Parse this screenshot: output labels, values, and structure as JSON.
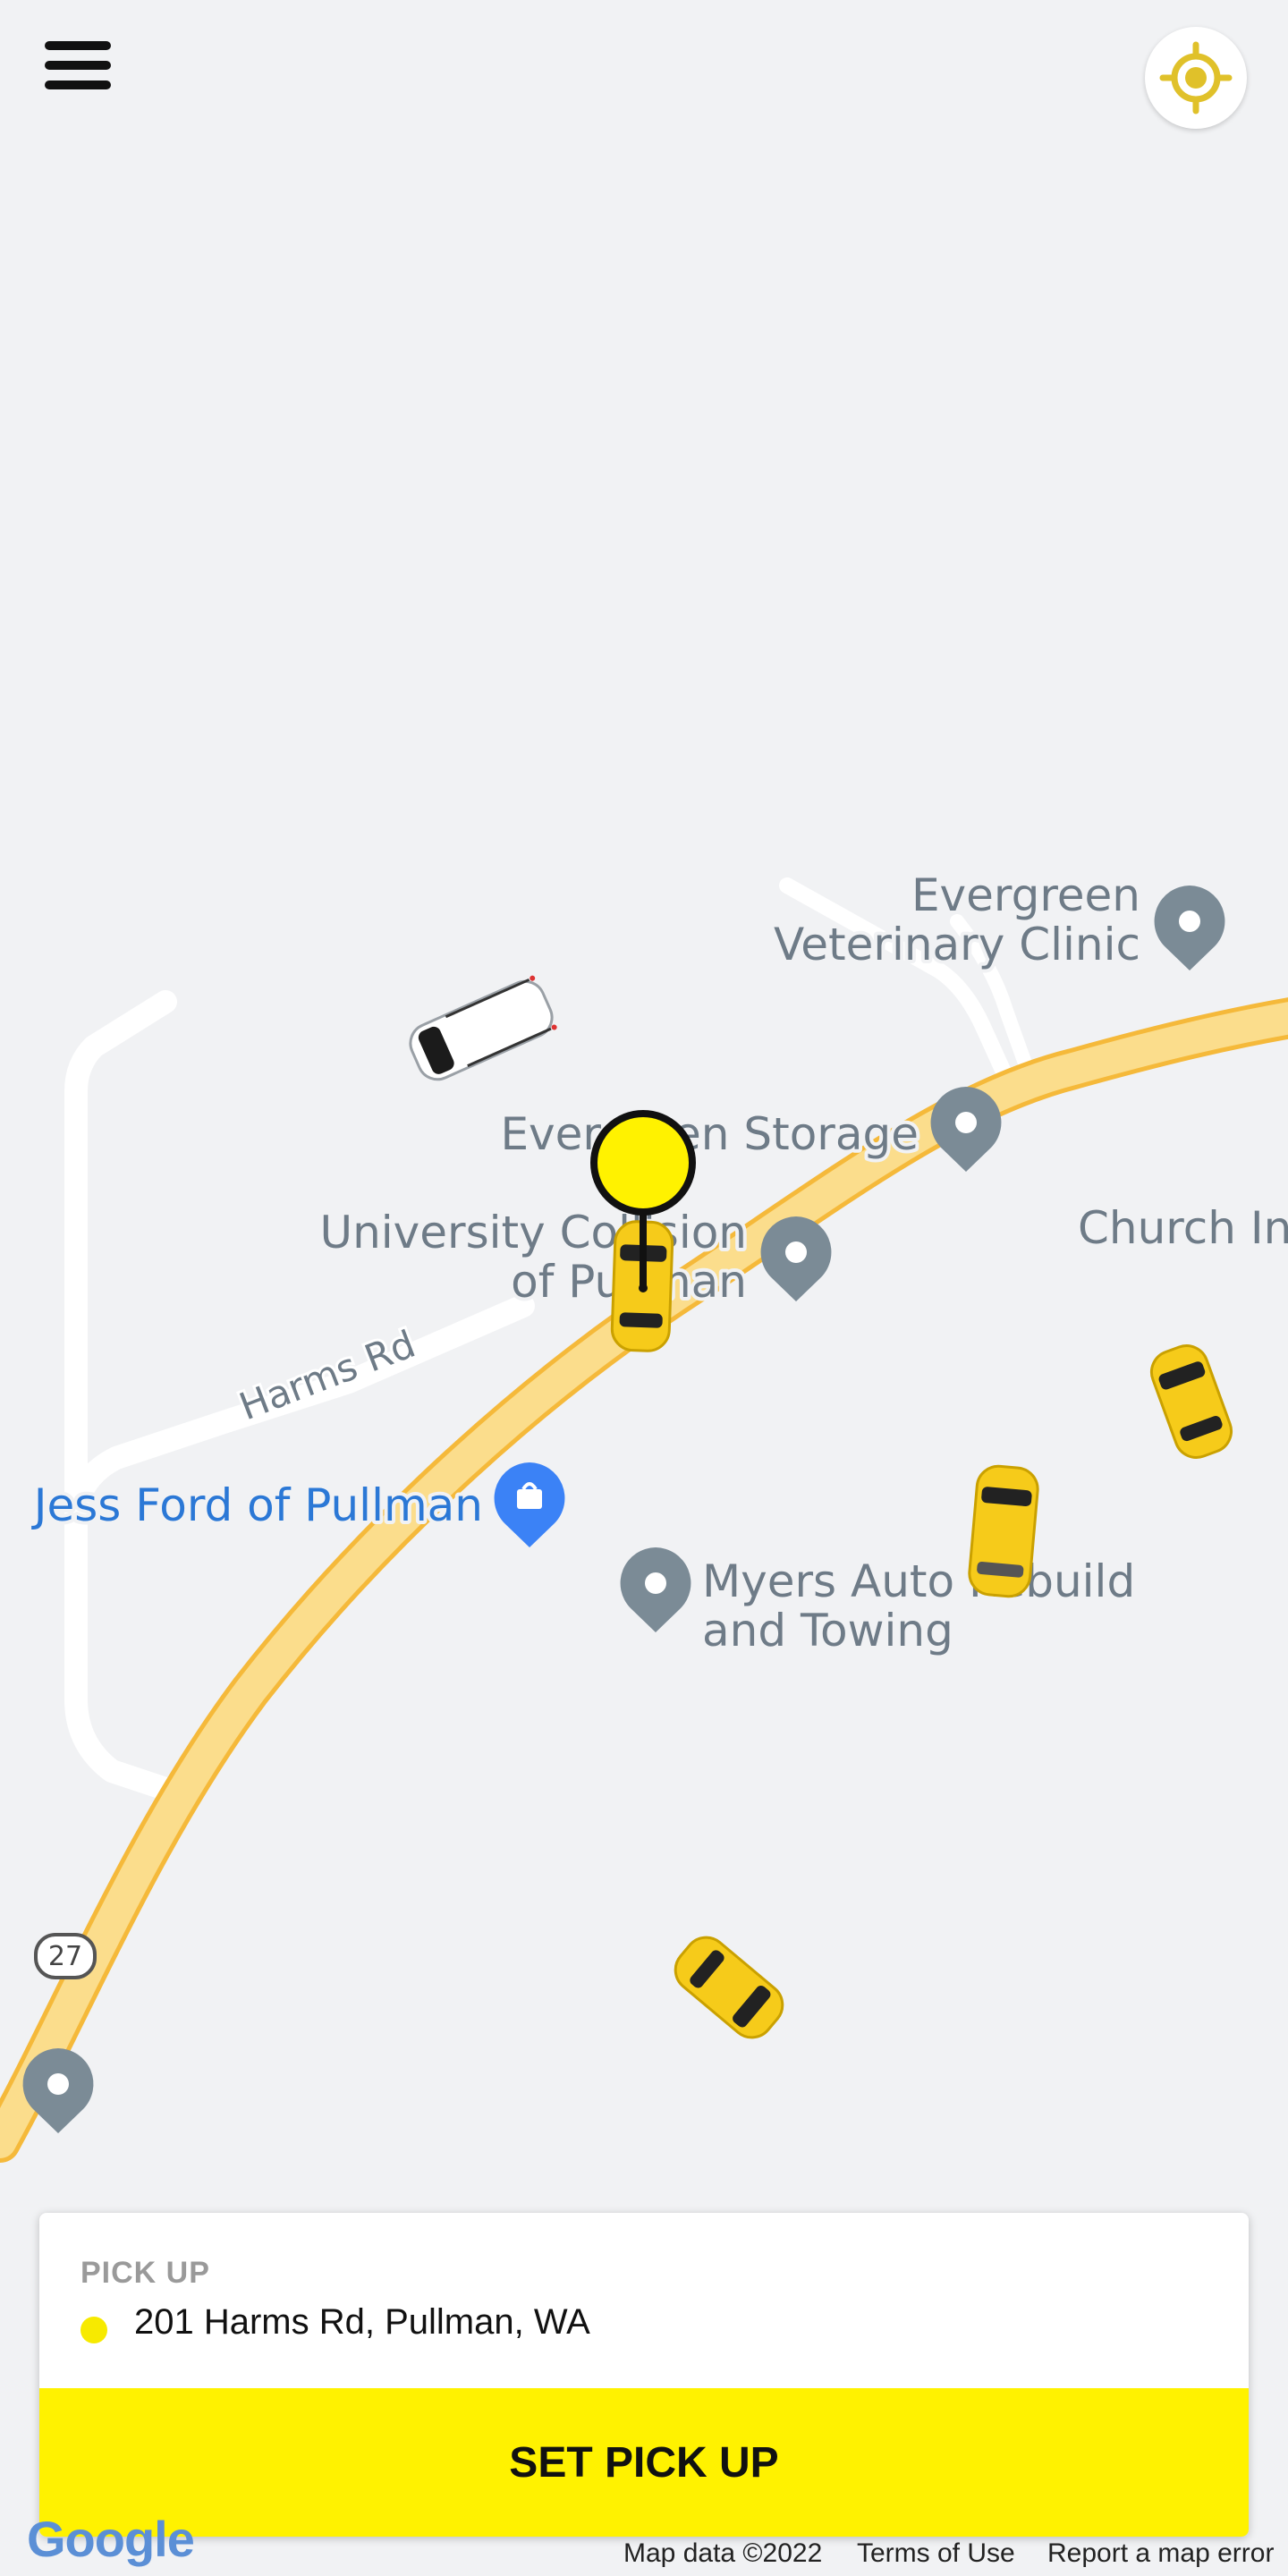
{
  "map": {
    "pois": {
      "evergreen_vet": [
        "Evergreen",
        "Veterinary Clinic"
      ],
      "evergreen_storage": "Evergreen Storage",
      "university_collision": [
        "University Collision",
        "of Pullman"
      ],
      "church": "Church In",
      "jess_ford": "Jess Ford of Pullman",
      "myers_auto": [
        "Myers Auto Rebuild",
        "and Towing"
      ]
    },
    "roads": {
      "harms_rd": "Harms Rd",
      "highway_shield": "27"
    }
  },
  "top_bar": {
    "menu_icon": "hamburger-menu-icon",
    "locate_icon": "crosshair-location-icon"
  },
  "pickup_card": {
    "section_label": "PICK UP",
    "address": "201 Harms Rd, Pullman, WA",
    "button_label": "SET PICK UP",
    "accent_color": "#fff200"
  },
  "attribution": {
    "logo": "Google",
    "map_data": "Map data ©2022",
    "terms": "Terms of Use",
    "report": "Report a map error"
  }
}
